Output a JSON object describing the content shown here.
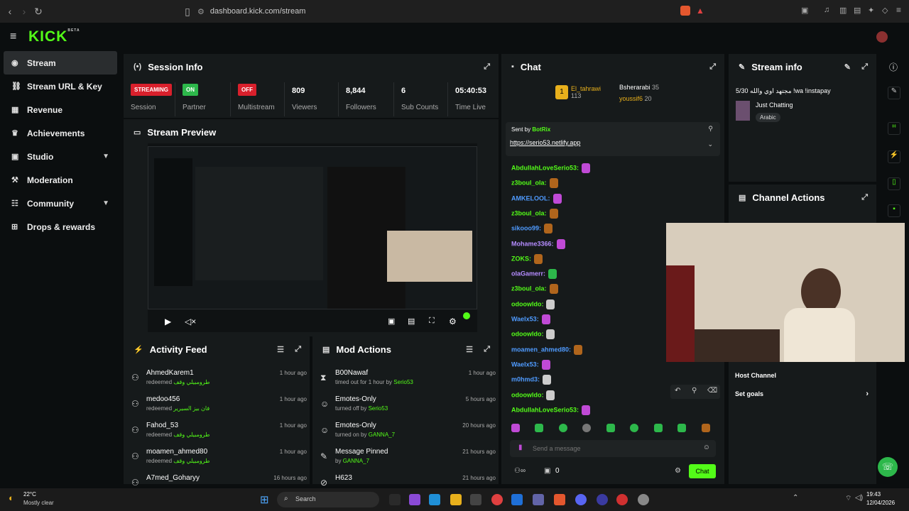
{
  "browser": {
    "url": "dashboard.kick.com/stream"
  },
  "brand": {
    "logo": "KICK",
    "beta": "BETA",
    "accent": "#53fc18"
  },
  "sidebar": {
    "items": [
      {
        "label": "Stream",
        "icon": "stream-icon"
      },
      {
        "label": "Stream URL & Key",
        "icon": "link-icon"
      },
      {
        "label": "Revenue",
        "icon": "chart-icon"
      },
      {
        "label": "Achievements",
        "icon": "trophy-icon"
      },
      {
        "label": "Studio",
        "icon": "studio-icon"
      },
      {
        "label": "Moderation",
        "icon": "gavel-icon"
      },
      {
        "label": "Community",
        "icon": "community-icon"
      },
      {
        "label": "Drops & rewards",
        "icon": "gift-icon"
      }
    ]
  },
  "session": {
    "title": "Session Info",
    "cells": [
      {
        "value": "STREAMING",
        "label": "Session"
      },
      {
        "value": "ON",
        "label": "Partner"
      },
      {
        "value": "OFF",
        "label": "Multistream"
      },
      {
        "value": "809",
        "label": "Viewers"
      },
      {
        "value": "8,844",
        "label": "Followers"
      },
      {
        "value": "6",
        "label": "Sub Counts"
      },
      {
        "value": "05:40:53",
        "label": "Time Live"
      }
    ]
  },
  "preview": {
    "title": "Stream Preview"
  },
  "activity": {
    "title": "Activity Feed",
    "rows": [
      {
        "name": "AhmedKarem1",
        "action": "redeemed",
        "reward": "طرومبيلي وقف",
        "time": "1 hour ago"
      },
      {
        "name": "medoo456",
        "action": "redeemed",
        "reward": "فان بيز السيرير",
        "time": "1 hour ago"
      },
      {
        "name": "Fahod_53",
        "action": "redeemed",
        "reward": "طرومبيلي وقف",
        "time": "1 hour ago"
      },
      {
        "name": "moamen_ahmed80",
        "action": "redeemed",
        "reward": "طرومبيلي وقف",
        "time": "1 hour ago"
      },
      {
        "name": "A7med_Goharyy",
        "action": "",
        "reward": "",
        "time": "16 hours ago"
      }
    ]
  },
  "mod": {
    "title": "Mod Actions",
    "rows": [
      {
        "name": "B00Nawaf",
        "action": "timed out for 1 hour by",
        "by": "Serio53",
        "time": "1 hour ago"
      },
      {
        "name": "Emotes-Only",
        "action": "turned off by",
        "by": "Serio53",
        "time": "5 hours ago"
      },
      {
        "name": "Emotes-Only",
        "action": "turned on by",
        "by": "GANNA_7",
        "time": "20 hours ago"
      },
      {
        "name": "Message Pinned",
        "action": "by",
        "by": "GANNA_7",
        "time": "21 hours ago"
      },
      {
        "name": "H623",
        "action": "",
        "by": "",
        "time": "21 hours ago"
      }
    ]
  },
  "chat": {
    "title": "Chat",
    "top": [
      {
        "name": "El_tahrawi",
        "count": "113"
      },
      {
        "name": "Bsherarabi",
        "count": "35"
      },
      {
        "name": "youssif6",
        "count": "20"
      }
    ],
    "pinned": {
      "sent_by": "Sent by",
      "bot": "BotRix",
      "link": "https://serio53.netlify.app"
    },
    "messages": [
      {
        "user": "AbdullahLoveSerio53:",
        "color": "#53fc18"
      },
      {
        "user": "z3boul_ola:",
        "color": "#53fc18"
      },
      {
        "user": "AMKELOOL:",
        "color": "#4f9bff"
      },
      {
        "user": "z3boul_ola:",
        "color": "#53fc18"
      },
      {
        "user": "sikooo99:",
        "color": "#4f9bff"
      },
      {
        "user": "Mohame3366:",
        "color": "#b58cff"
      },
      {
        "user": "ZOKS:",
        "color": "#53fc18"
      },
      {
        "user": "olaGamerr:",
        "color": "#b58cff"
      },
      {
        "user": "z3boul_ola:",
        "color": "#53fc18"
      },
      {
        "user": "odoowldo:",
        "color": "#53fc18"
      },
      {
        "user": "Waelx53:",
        "color": "#4f9bff"
      },
      {
        "user": "odoowldo:",
        "color": "#53fc18"
      },
      {
        "user": "moamen_ahmed80:",
        "color": "#4f9bff"
      },
      {
        "user": "Waelx53:",
        "color": "#4f9bff"
      },
      {
        "user": "m0hmd3:",
        "color": "#4f9bff"
      },
      {
        "user": "odoowldo:",
        "color": "#53fc18"
      },
      {
        "user": "AbdullahLoveSerio53:",
        "color": "#53fc18"
      }
    ],
    "input_placeholder": "Send a message",
    "count_label": "0",
    "send_label": "Chat"
  },
  "stream_info": {
    "title": "Stream info",
    "stream_title": "5/30 مجتهد اوي والله !wa !instapay",
    "category": "Just Chatting",
    "language": "Arabic"
  },
  "channel_actions": {
    "title": "Channel Actions",
    "host": "Host Channel",
    "goals": "Set goals"
  },
  "taskbar": {
    "temp": "22°C",
    "weather": "Mostly clear",
    "search": "Search",
    "time": "19:43",
    "date": "12/04/2026"
  }
}
